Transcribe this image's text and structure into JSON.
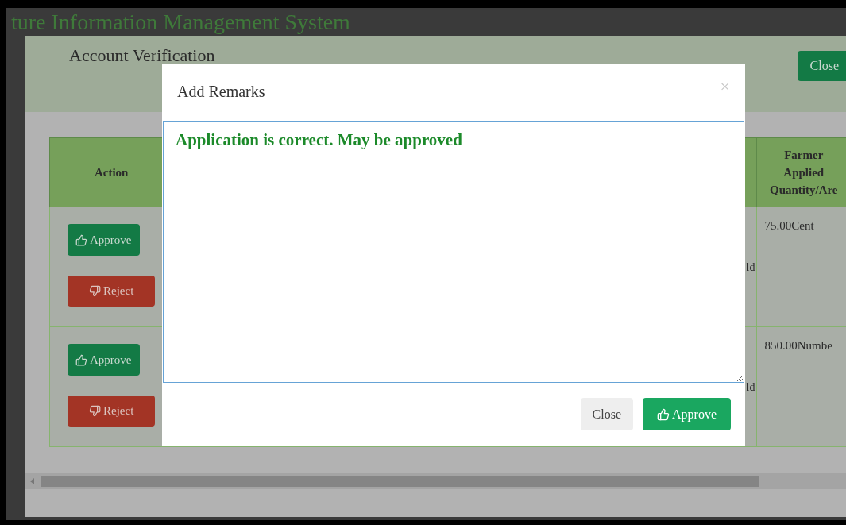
{
  "page": {
    "title": "ture Information Management System"
  },
  "verification": {
    "title": "Account Verification",
    "close_button": "Close",
    "table": {
      "columns": [
        "Action",
        "Farmer Applied Quantity/Are"
      ],
      "rows": [
        {
          "approve": "Approve",
          "reject": "Reject",
          "column_2": "ld",
          "quantity": "75.00Cent"
        },
        {
          "approve": "Approve",
          "reject": "Reject",
          "column_2": "ld",
          "quantity": "850.00Numbe"
        }
      ]
    }
  },
  "remarks_dialog": {
    "title": "Add Remarks",
    "close_icon": "×",
    "remark": "Application is correct. May be approved",
    "buttons": {
      "close": "Close",
      "approve": "Approve"
    }
  }
}
